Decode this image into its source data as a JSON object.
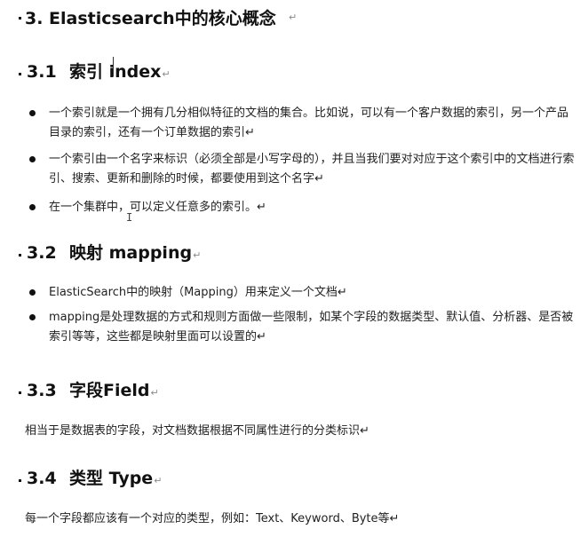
{
  "sections": {
    "s3": {
      "title": "3. Elasticsearch中的核心概念",
      "mark": "↵"
    },
    "s31": {
      "num": "3.1",
      "title_pre": "索引 ",
      "title_post": "index",
      "mark": "↵",
      "bullets": [
        "一个索引就是一个拥有几分相似特征的文档的集合。比如说，可以有一个客户数据的索引，另一个产品目录的索引，还有一个订单数据的索引↵",
        "一个索引由一个名字来标识（必须全部是小写字母的），并且当我们要对对应于这个索引中的文档进行索引、搜索、更新和删除的时候，都要使用到这个名字↵",
        "在一个集群中，可以定义任意多的索引。↵"
      ]
    },
    "s32": {
      "num": "3.2",
      "title": "映射  mapping",
      "mark": "↵",
      "bullets": [
        "ElasticSearch中的映射（Mapping）用来定义一个文档↵",
        "mapping是处理数据的方式和规则方面做一些限制，如某个字段的数据类型、默认值、分析器、是否被索引等等，这些都是映射里面可以设置的↵"
      ]
    },
    "s33": {
      "num": "3.3",
      "title": "字段Field",
      "mark": "↵",
      "body": "相当于是数据表的字段，对文档数据根据不同属性进行的分类标识↵"
    },
    "s34": {
      "num": "3.4",
      "title": "类型  Type",
      "mark": "↵",
      "body": "每一个字段都应该有一个对应的类型，例如：Text、Keyword、Byte等↵"
    }
  }
}
